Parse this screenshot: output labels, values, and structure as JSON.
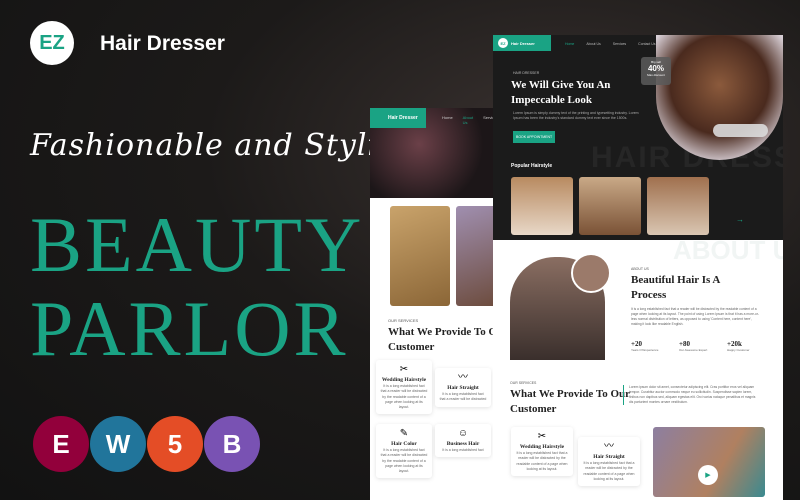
{
  "banner": {
    "logo": "EZ",
    "brand": "Hair Dresser",
    "tagline": "Fashionable and Stylish",
    "title_line1": "BEAUTY",
    "title_line2": "PARLOR",
    "accent": "#1aa384",
    "tech": [
      {
        "name": "elementor-icon",
        "label": "E",
        "color": "#92003b"
      },
      {
        "name": "wordpress-icon",
        "label": "W",
        "color": "#21759b"
      },
      {
        "name": "html5-icon",
        "label": "5",
        "color": "#e44d26"
      },
      {
        "name": "bootstrap-icon",
        "label": "B",
        "color": "#7952b3"
      }
    ]
  },
  "back": {
    "logo": "EZ",
    "brand": "Hair Dresser",
    "nav": [
      "Home",
      "About Us",
      "Services"
    ],
    "eyebrow": "OUR SERVICES",
    "heading": "What We Provide To Our Customer",
    "services": [
      {
        "title": "Wedding Hairstyle",
        "text": "It is a long established fact that a reader will be distracted by the readable content of a page when looking at its layout."
      },
      {
        "title": "Hair Straight",
        "text": "It is a long established fact that a reader will be distracted"
      },
      {
        "title": "Hair Color",
        "text": "It is a long established fact that a reader will be distracted by the readable content of a page when looking at its layout."
      },
      {
        "title": "Business Hair",
        "text": "It is a long established fact"
      }
    ]
  },
  "front": {
    "logo": "EZ",
    "brand": "Hair Dresser",
    "nav": [
      "Home",
      "About Us",
      "Services",
      "Contact Us"
    ],
    "eyebrow": "HAIR DRESSER",
    "hero_title": "We Will Give You An Impeccable Look",
    "hero_text": "Lorem Ipsum is simply dummy text of the printing and typesetting industry. Lorem Ipsum has been the industry's standard dummy text ever since the 1500s.",
    "cta": "BOOK APPOINTMENT",
    "badge_top": "Big sell",
    "badge_value": "40%",
    "badge_bottom": "Max discount",
    "watermark": "HAIR DRESSER",
    "popular": "Popular Hairstyle",
    "about": {
      "watermark": "ABOUT US",
      "eyebrow": "ABOUT US",
      "heading": "Beautiful Hair Is A Process",
      "text": "It is a long established fact that a reader will be distracted by the readable content of a page when looking at its layout. The point of using Lorem Ipsum is that it has a more-or-less normal distribution of letters, as opposed to using 'Content here, content here', making it look like readable English.",
      "stats": [
        {
          "value": "+20",
          "label": "Years Of Experience"
        },
        {
          "value": "+80",
          "label": "Our Awesome Expert"
        },
        {
          "value": "+20k",
          "label": "Happy Customer"
        }
      ]
    },
    "services": {
      "eyebrow": "OUR SERVICES",
      "heading": "What We Provide To Our Customer",
      "text": "Lorem ipsum dolor sit amet, consectetur adipiscing elit. Cras porttitor eros vel aliquam tempor. Curabitur auctor commodo neque eu sollicitudin. Suspendisse sapien lorem, finibus non dapibus sed, aliquam egestas elit. Orci varius natoque penatibus et magnis dis parturient montes ornare vestibulum.",
      "cards": [
        {
          "title": "Wedding Hairstyle",
          "text": "It is a long established fact that a reader will be distracted by the readable content of a page when looking at its layout."
        },
        {
          "title": "Hair Straight",
          "text": "It is a long established fact that a reader will be distracted by the readable content of a page when looking at its layout."
        }
      ]
    }
  }
}
